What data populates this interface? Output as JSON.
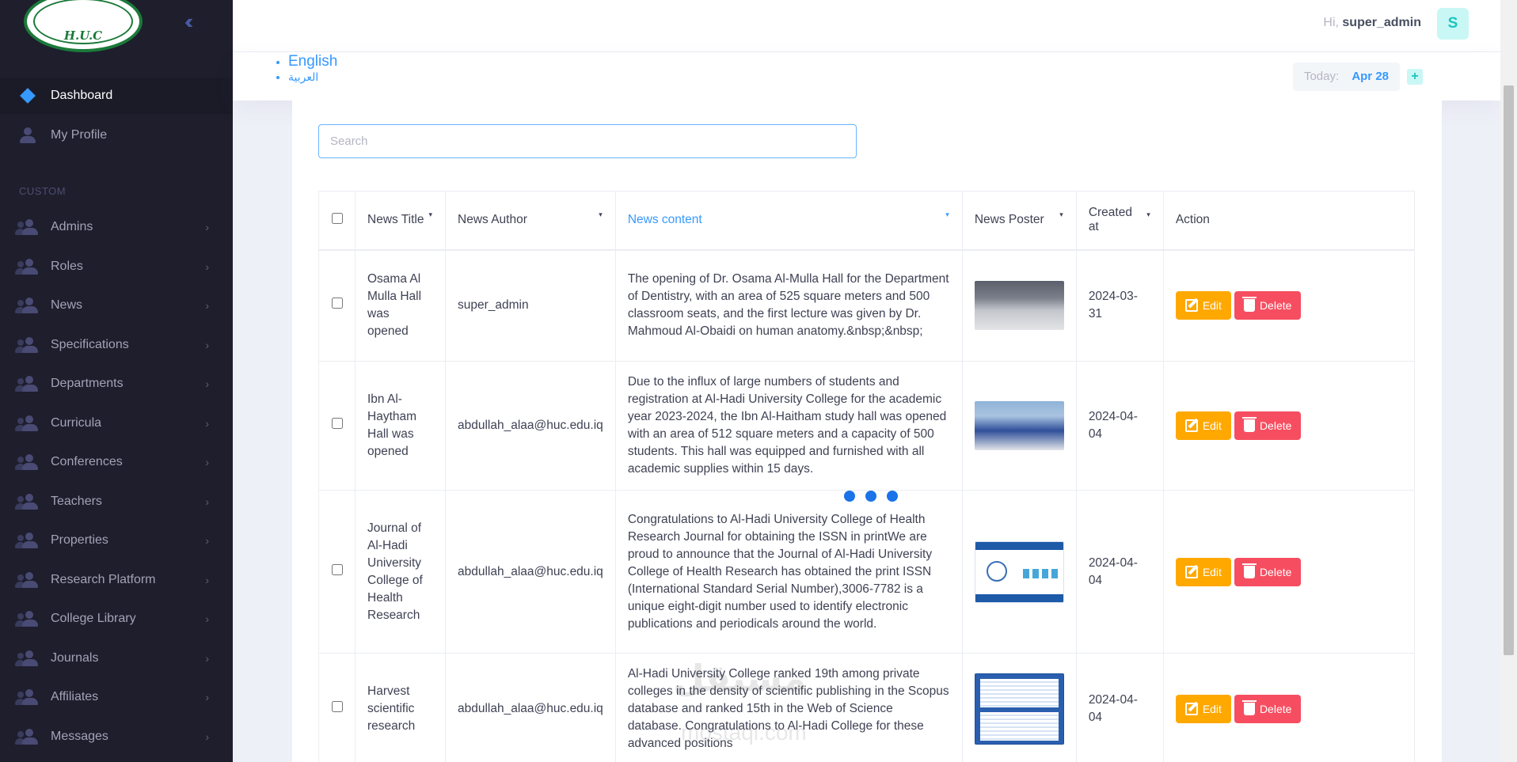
{
  "app": {
    "logo_text": "H.U.C"
  },
  "sidebar": {
    "section_label": "CUSTOM",
    "top_items": [
      {
        "label": "Dashboard"
      },
      {
        "label": "My Profile"
      }
    ],
    "items": [
      {
        "label": "Admins"
      },
      {
        "label": "Roles"
      },
      {
        "label": "News"
      },
      {
        "label": "Specifications"
      },
      {
        "label": "Departments"
      },
      {
        "label": "Curricula"
      },
      {
        "label": "Conferences"
      },
      {
        "label": "Teachers"
      },
      {
        "label": "Properties"
      },
      {
        "label": "Research Platform"
      },
      {
        "label": "College Library"
      },
      {
        "label": "Journals"
      },
      {
        "label": "Affiliates"
      },
      {
        "label": "Messages"
      }
    ]
  },
  "header": {
    "greeting": "Hi,",
    "username": "super_admin",
    "avatar_letter": "S"
  },
  "subheader": {
    "languages": [
      "English",
      "العربية"
    ],
    "today_label": "Today:",
    "today_value": "Apr 28",
    "plus": "+"
  },
  "search": {
    "placeholder": "Search",
    "value": ""
  },
  "table": {
    "columns": [
      "News Title",
      "News Author",
      "News content",
      "News Poster",
      "Created at",
      "Action"
    ],
    "edit_label": "Edit",
    "delete_label": "Delete",
    "rows": [
      {
        "title": "Osama Al Mulla Hall was opened",
        "author": "super_admin",
        "content": "The opening of Dr. Osama Al-Mulla Hall for the Department of Dentistry, with an area of 525 square meters and 500 classroom seats, and the first lecture was given by Dr. Mahmoud Al-Obaidi on human anatomy.&nbsp;&nbsp;",
        "created": "2024-03-31"
      },
      {
        "title": "Ibn Al-Haytham Hall was opened",
        "author": "abdullah_alaa@huc.edu.iq",
        "content": "Due to the influx of large numbers of students and registration at Al-Hadi University College for the academic year 2023-2024, the Ibn Al-Haitham study hall was opened with an area of 512 square meters and a capacity of 500 students. This hall was equipped and furnished with all academic supplies within 15 days.",
        "created": "2024-04-04"
      },
      {
        "title": "Journal of Al-Hadi University College of Health Research",
        "author": "abdullah_alaa@huc.edu.iq",
        "content": "Congratulations to Al-Hadi University College of Health Research Journal for obtaining the ISSN in printWe are proud to announce that the Journal of Al-Hadi University College of Health Research has obtained the print ISSN (International Standard Serial Number),3006-7782 is a unique eight-digit number used to identify electronic publications and periodicals around the world.",
        "created": "2024-04-04"
      },
      {
        "title": "Harvest scientific research",
        "author": "abdullah_alaa@huc.edu.iq",
        "content": "Al-Hadi University College ranked 19th among private colleges in the density of scientific publishing in the Scopus database and ranked 15th in the Web of Science database. Congratulations to Al-Hadi College for these advanced positions",
        "created": "2024-04-04"
      }
    ]
  },
  "watermark": {
    "text": "مستقل",
    "sub": "mostaql.com"
  }
}
